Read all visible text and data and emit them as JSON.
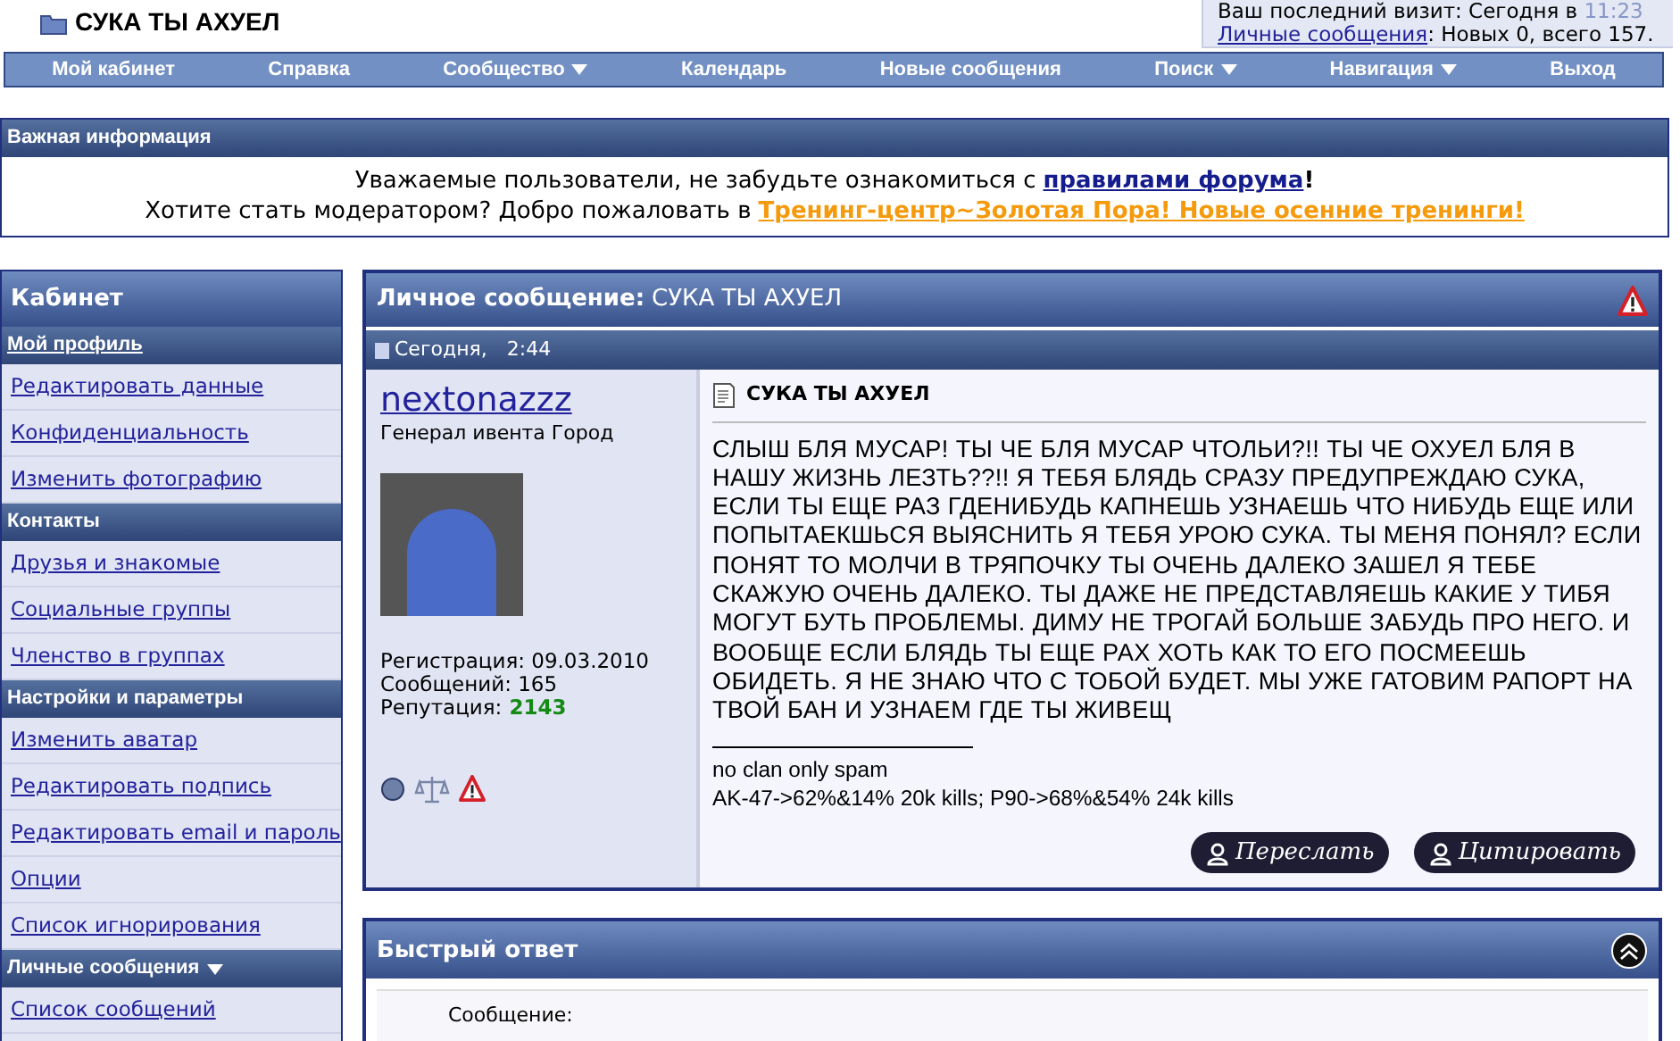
{
  "page_title": "СУКА ТЫ АХУЕЛ",
  "visit": {
    "last_visit_label": "Ваш последний визит: Сегодня в",
    "last_visit_time": "11:23",
    "pm_link": "Личные сообщения",
    "pm_counts": ": Новых 0, всего 157."
  },
  "nav": [
    {
      "label": "Мой кабинет",
      "dropdown": false
    },
    {
      "label": "Справка",
      "dropdown": false
    },
    {
      "label": "Сообщество",
      "dropdown": true
    },
    {
      "label": "Календарь",
      "dropdown": false
    },
    {
      "label": "Новые сообщения",
      "dropdown": false
    },
    {
      "label": "Поиск",
      "dropdown": true
    },
    {
      "label": "Навигация",
      "dropdown": true
    },
    {
      "label": "Выход",
      "dropdown": false
    }
  ],
  "notice": {
    "title": "Важная информация",
    "line_1": "Уважаемые пользователи, не забудьте ознакомиться с",
    "rules_link": "правилами форума",
    "line_1_end": "!",
    "line_2": "Хотите стать модератором? Добро пожаловать в",
    "training_link": "Тренинг-центр~Золотая Пора! Новые осенние тренинги!"
  },
  "sidebar": {
    "title": "Кабинет",
    "items": [
      {
        "kind": "header",
        "label": "Мой профиль",
        "link": true,
        "dropdown": false
      },
      {
        "kind": "link",
        "label": "Редактировать данные"
      },
      {
        "kind": "link",
        "label": "Конфиденциальность"
      },
      {
        "kind": "link",
        "label": "Изменить фотографию"
      },
      {
        "kind": "header",
        "label": "Контакты",
        "link": false,
        "dropdown": false
      },
      {
        "kind": "link",
        "label": "Друзья и знакомые"
      },
      {
        "kind": "link",
        "label": "Социальные группы"
      },
      {
        "kind": "link",
        "label": "Членство в группах"
      },
      {
        "kind": "header",
        "label": "Настройки и параметры",
        "link": false,
        "dropdown": false
      },
      {
        "kind": "link",
        "label": "Изменить аватар"
      },
      {
        "kind": "link",
        "label": "Редактировать подпись"
      },
      {
        "kind": "link",
        "label": "Редактировать email и пароль"
      },
      {
        "kind": "link",
        "label": "Опции"
      },
      {
        "kind": "link",
        "label": "Список игнорирования"
      },
      {
        "kind": "header",
        "label": "Личные сообщения",
        "link": false,
        "dropdown": true
      },
      {
        "kind": "link",
        "label": "Список сообщений"
      }
    ]
  },
  "message": {
    "header_label": "Личное сообщение:",
    "header_title": "СУКА ТЫ АХУЕЛ",
    "date": "Сегодня,",
    "time": "2:44",
    "author": {
      "name": "nextonazzz",
      "rank": "Генерал ивента Город",
      "registration": "Регистрация: 09.03.2010",
      "posts": "Сообщений: 165",
      "reputation_label": "Репутация:",
      "reputation": "2143"
    },
    "title": "СУКА ТЫ АХУЕЛ",
    "body": "СЛЫШ БЛЯ МУСАР! ТЫ ЧЕ БЛЯ МУСАР ЧТОЛЬИ?!! ТЫ ЧЕ ОХУЕЛ БЛЯ В НАШУ ЖИЗНЬ ЛЕЗТЬ??!! Я ТЕБЯ БЛЯДЬ СРАЗУ ПРЕДУПРЕЖДАЮ СУКА, ЕСЛИ ТЫ ЕЩЕ РАЗ ГДЕНИБУДЬ КАПНЕШЬ УЗНАЕШЬ ЧТО НИБУДЬ ЕЩЕ ИЛИ ПОПЫТАЕКШЬСЯ ВЫЯСНИТЬ Я ТЕБЯ УРОЮ СУКА. ТЫ МЕНЯ ПОНЯЛ? ЕСЛИ ПОНЯТ ТО МОЛЧИ В ТРЯПОЧКУ ТЫ ОЧЕНЬ ДАЛЕКО ЗАШЕЛ Я ТЕБЕ СКАЖУЮ ОЧЕНЬ ДАЛЕКО. ТЫ ДАЖЕ НЕ ПРЕДСТАВЛЯЕШЬ КАКИЕ У ТИБЯ МОГУТ БУТЬ ПРОБЛЕМЫ. ДИМУ НЕ ТРОГАЙ БОЛЬШЕ ЗАБУДЬ ПРО НЕГО. И ВООБЩЕ ЕСЛИ БЛЯДЬ ТЫ ЕЩЕ РАХ ХОТЬ КАК ТО ЕГО ПОСМЕЕШЬ ОБИДЕТЬ. Я НЕ ЗНАЮ ЧТО С ТОБОЙ БУДЕТ. МЫ УЖЕ ГАТОВИМ РАПОРТ НА ТВОЙ БАН И УЗНАЕМ ГДЕ ТЫ ЖИВЕЩ",
    "signature": [
      "no clan only spam",
      "AK-47->62%&14% 20k kills; P90->68%&54% 24k kills"
    ],
    "buttons": [
      "Переслать",
      "Цитировать"
    ]
  },
  "quick_reply": {
    "title": "Быстрый ответ",
    "field_label": "Сообщение:"
  }
}
